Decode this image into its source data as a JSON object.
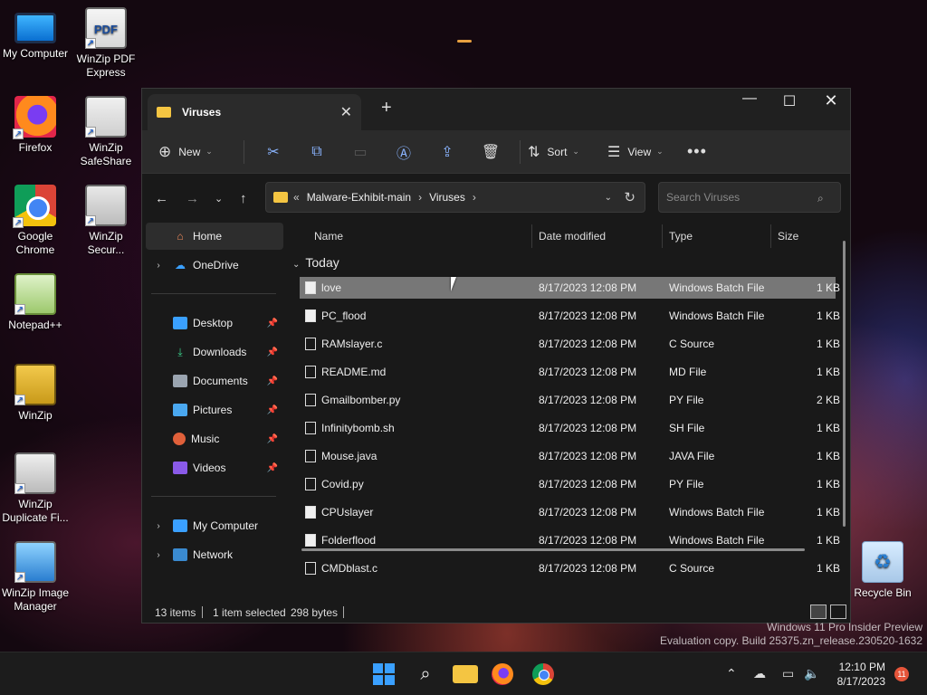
{
  "desktop": {
    "icons": [
      {
        "label": "My Computer",
        "icon": "monitor-icon"
      },
      {
        "label": "WinZip PDF Express",
        "icon": "pdf-icon"
      },
      {
        "label": "Firefox",
        "icon": "firefox-icon"
      },
      {
        "label": "WinZip SafeShare",
        "icon": "share-icon"
      },
      {
        "label": "Google Chrome",
        "icon": "chrome-icon"
      },
      {
        "label": "WinZip Secur...",
        "icon": "secure-icon"
      },
      {
        "label": "Notepad++",
        "icon": "notepad-icon"
      },
      {
        "label": "WinZip",
        "icon": "winzip-icon"
      },
      {
        "label": "WinZip Duplicate Fi...",
        "icon": "duplicate-icon"
      },
      {
        "label": "WinZip Image Manager",
        "icon": "image-manager-icon"
      },
      {
        "label": "Recycle Bin",
        "icon": "recycle-bin-icon"
      }
    ],
    "pdf_badge": "PDF"
  },
  "window": {
    "tab_title": "Viruses",
    "new_tab": "+",
    "controls": {
      "minimize": "—",
      "maximize": "☐",
      "close": "✕"
    }
  },
  "toolbar": {
    "new_label": "New",
    "sort_label": "Sort",
    "view_label": "View",
    "more": "•••"
  },
  "address": {
    "overflow": "«",
    "crumbs": [
      "Malware-Exhibit-main",
      "Viruses"
    ],
    "search_placeholder": "Search Viruses"
  },
  "sidebar": {
    "items": [
      {
        "label": "Home",
        "icon": "home-icon",
        "selected": true
      },
      {
        "label": "OneDrive",
        "icon": "onedrive-icon"
      },
      {
        "label": "Desktop",
        "icon": "desktop-icon",
        "pinned": true
      },
      {
        "label": "Downloads",
        "icon": "downloads-icon",
        "pinned": true
      },
      {
        "label": "Documents",
        "icon": "documents-icon",
        "pinned": true
      },
      {
        "label": "Pictures",
        "icon": "pictures-icon",
        "pinned": true
      },
      {
        "label": "Music",
        "icon": "music-icon",
        "pinned": true
      },
      {
        "label": "Videos",
        "icon": "videos-icon",
        "pinned": true
      },
      {
        "label": "My Computer",
        "icon": "computer-icon"
      },
      {
        "label": "Network",
        "icon": "network-icon"
      }
    ]
  },
  "list": {
    "columns": {
      "name": "Name",
      "date": "Date modified",
      "type": "Type",
      "size": "Size"
    },
    "group": "Today",
    "files": [
      {
        "name": "love",
        "date": "8/17/2023 12:08 PM",
        "type": "Windows Batch File",
        "size": "1 KB",
        "selected": true
      },
      {
        "name": "PC_flood",
        "date": "8/17/2023 12:08 PM",
        "type": "Windows Batch File",
        "size": "1 KB"
      },
      {
        "name": "RAMslayer.c",
        "date": "8/17/2023 12:08 PM",
        "type": "C Source",
        "size": "1 KB"
      },
      {
        "name": "README.md",
        "date": "8/17/2023 12:08 PM",
        "type": "MD File",
        "size": "1 KB"
      },
      {
        "name": "Gmailbomber.py",
        "date": "8/17/2023 12:08 PM",
        "type": "PY File",
        "size": "2 KB"
      },
      {
        "name": "Infinitybomb.sh",
        "date": "8/17/2023 12:08 PM",
        "type": "SH File",
        "size": "1 KB"
      },
      {
        "name": "Mouse.java",
        "date": "8/17/2023 12:08 PM",
        "type": "JAVA File",
        "size": "1 KB"
      },
      {
        "name": "Covid.py",
        "date": "8/17/2023 12:08 PM",
        "type": "PY File",
        "size": "1 KB"
      },
      {
        "name": "CPUslayer",
        "date": "8/17/2023 12:08 PM",
        "type": "Windows Batch File",
        "size": "1 KB"
      },
      {
        "name": "Folderflood",
        "date": "8/17/2023 12:08 PM",
        "type": "Windows Batch File",
        "size": "1 KB"
      },
      {
        "name": "CMDblast.c",
        "date": "8/17/2023 12:08 PM",
        "type": "C Source",
        "size": "1 KB"
      }
    ]
  },
  "status": {
    "count": "13 items",
    "selection": "1 item selected",
    "size": "298 bytes"
  },
  "watermark": {
    "line1": "Windows 11 Pro Insider Preview",
    "line2": "Evaluation copy. Build 25375.zn_release.230520-1632"
  },
  "taskbar": {
    "time": "12:10 PM",
    "date": "8/17/2023",
    "notifications": "11"
  },
  "colors": {
    "accent": "#3aa0ff",
    "folder": "#f4c542",
    "selected_row": "#777777"
  }
}
